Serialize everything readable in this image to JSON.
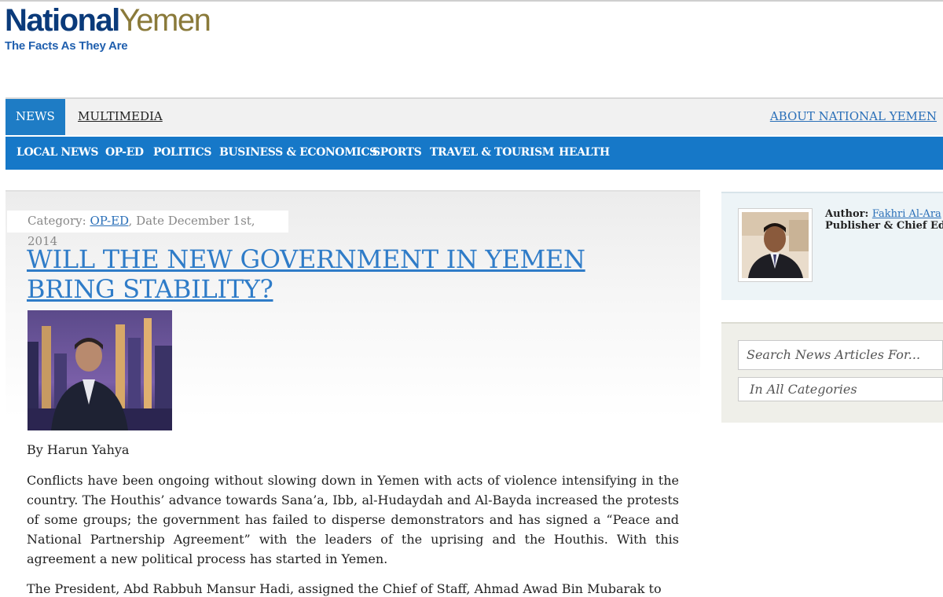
{
  "logo": {
    "part1": "National",
    "part2": "Yemen",
    "tagline": "The Facts As They Are"
  },
  "nav": {
    "primary": [
      "NEWS",
      "MULTIMEDIA"
    ],
    "about": "ABOUT NATIONAL YEMEN",
    "secondary": [
      "LOCAL NEWS",
      "OP-ED",
      "POLITICS",
      "BUSINESS & ECONOMICS",
      "SPORTS",
      "TRAVEL & TOURISM",
      "HEALTH"
    ]
  },
  "article": {
    "category_prefix": "Category: ",
    "category": "OP-ED",
    "date": ", Date December 1st, 2014",
    "title": "WILL THE NEW GOVERNMENT IN YEMEN BRING STABILITY?",
    "byline": "By Harun Yahya",
    "paragraph1": "Conflicts have been ongoing  without  slowing down in Yemen with acts of violence intensifying in the country. The Houthis’ advance towards Sana’a, Ibb,  al-Hudaydah and Al-Bayda increased the protests of some groups;  the government has failed to disperse demonstrators and has signed a “Peace and National Partnership Agreement” with the leaders of the uprising and the Houthis. With this agreement a new political process has started in Yemen.",
    "paragraph2": "The President, Abd Rabbuh Mansur Hadi, assigned the Chief of Staff, Ahmad Awad Bin Mubarak to"
  },
  "sidebar": {
    "author_label": "Author: ",
    "author_name": "Fakhri Al-Ara",
    "author_role": "Publisher & Chief Edit",
    "search_placeholder": "Search News Articles For...",
    "category_select": "In All Categories"
  },
  "colors": {
    "brand_blue": "#0a3a7a",
    "brand_gold": "#8a7a3a",
    "nav_blue": "#1678c8",
    "link_blue": "#2f7cc8"
  }
}
